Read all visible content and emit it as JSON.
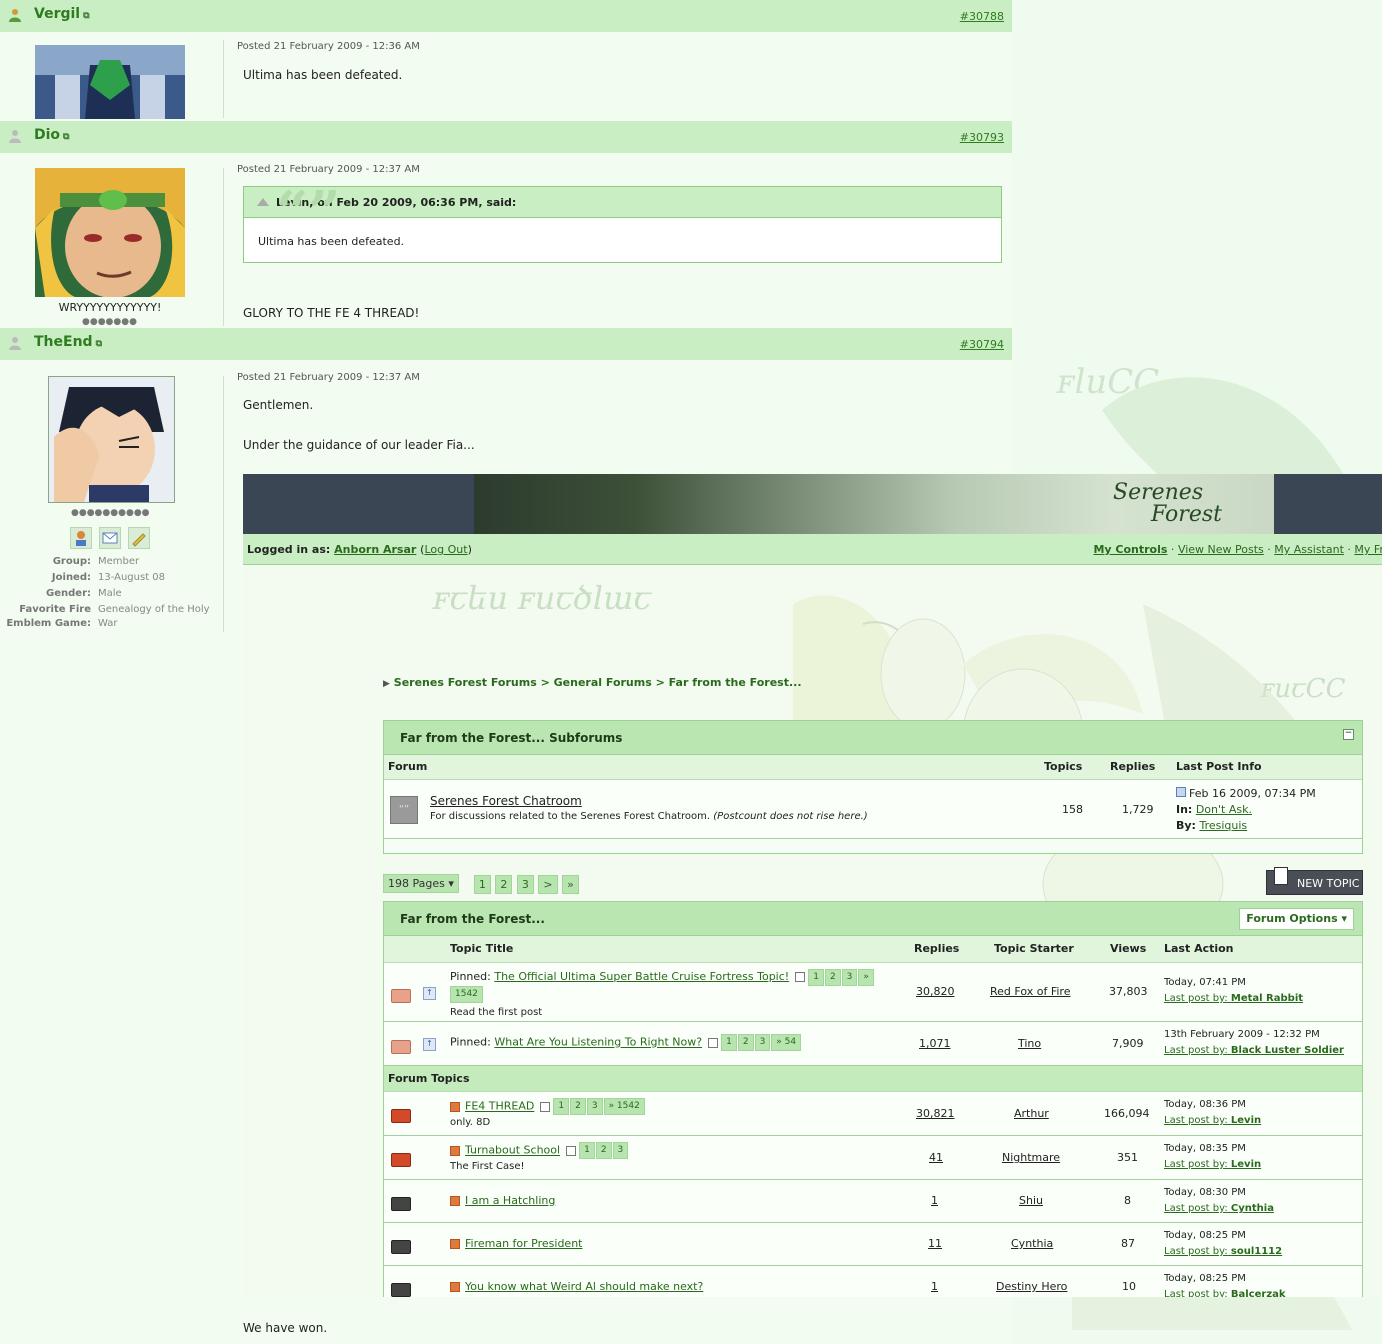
{
  "posts": [
    {
      "user": "Vergil",
      "post_id": "#30788",
      "posted": "Posted 21 February 2009 - 12:36 AM",
      "body": "Ultima has been defeated."
    },
    {
      "user": "Dio",
      "post_id": "#30793",
      "posted": "Posted 21 February 2009 - 12:37 AM",
      "quote_header": "Levin, on Feb 20 2009, 06:36 PM, said:",
      "quote_body": "Ultima has been defeated.",
      "body": "GLORY TO THE FE 4 THREAD!",
      "title": "WRYYYYYYYYYYYY!"
    },
    {
      "user": "TheEnd",
      "post_id": "#30794",
      "posted": "Posted 21 February 2009 - 12:37 AM",
      "body_line1": "Gentlemen.",
      "body_line2": "Under the guidance of our leader Fia...",
      "pips": "●●●●●●●●●●",
      "profile": [
        {
          "label": "Group:",
          "value": "Member"
        },
        {
          "label": "Joined:",
          "value": "13-August 08"
        },
        {
          "label": "Gender:",
          "value": "Male"
        },
        {
          "label": "Favorite Fire",
          "value": "Genealogy of the Holy"
        },
        {
          "label": "Emblem Game:",
          "value": "War"
        }
      ],
      "after_text": "We have won."
    }
  ],
  "icons": {
    "user": "user-icon",
    "external": "external-link-icon",
    "quote": "quote-icon"
  },
  "forum": {
    "logo_line1": "Serenes",
    "logo_line2": "Forest",
    "logged_in_label": "Logged in as:",
    "logged_in_user": "Anborn Arsar",
    "logout_label": "Log Out",
    "nav": [
      "My Controls",
      "View New Posts",
      "My Assistant",
      "My Fri"
    ],
    "breadcrumb": [
      "Serenes Forest Forums",
      "General Forums",
      "Far from the Forest..."
    ],
    "subforums": {
      "title": "Far from the Forest... Subforums",
      "columns": [
        "Forum",
        "Topics",
        "Replies",
        "Last Post Info"
      ],
      "rows": [
        {
          "name": "Serenes Forest Chatroom",
          "desc": "For discussions related to the Serenes Forest Chatroom.",
          "desc_note": "(Postcount does not rise here.)",
          "topics": "158",
          "replies": "1,729",
          "last_date": "Feb 16 2009, 07:34 PM",
          "in_label": "In:",
          "in_topic": "Don't Ask.",
          "by_label": "By:",
          "by_user": "Tresiquis"
        }
      ]
    },
    "pagination": {
      "pages_label": "198 Pages",
      "links": [
        "1",
        "2",
        "3",
        ">",
        "»"
      ]
    },
    "new_topic_label": "NEW TOPIC",
    "topics": {
      "title": "Far from the Forest...",
      "options_label": "Forum Options",
      "columns": [
        "Topic Title",
        "Replies",
        "Topic Starter",
        "Views",
        "Last Action"
      ],
      "section_label": "Forum Topics",
      "pinned_prefix": "Pinned:",
      "last_post_by_label": "Last post by:",
      "pinned": [
        {
          "title": "The Official Ultima Super Battle Cruise Fortress Topic!",
          "pages": [
            "1",
            "2",
            "3",
            "»"
          ],
          "last_page": "1542",
          "desc": "Read the first post",
          "replies": "30,820",
          "starter": "Red Fox of Fire",
          "views": "37,803",
          "last_date": "Today, 07:41 PM",
          "last_by": "Metal Rabbit"
        },
        {
          "title": "What Are You Listening To Right Now?",
          "pages": [
            "1",
            "2",
            "3",
            "» 54"
          ],
          "replies": "1,071",
          "starter": "Tino",
          "views": "7,909",
          "last_date": "13th February 2009 - 12:32 PM",
          "last_by": "Black Luster Soldier"
        }
      ],
      "rows": [
        {
          "title": "FE4 THREAD",
          "pages": [
            "1",
            "2",
            "3",
            "» 1542"
          ],
          "desc": "only. 8D",
          "replies": "30,821",
          "starter": "Arthur",
          "views": "166,094",
          "last_date": "Today, 08:36 PM",
          "last_by": "Levin"
        },
        {
          "title": "Turnabout School",
          "pages": [
            "1",
            "2",
            "3"
          ],
          "desc": "The First Case!",
          "replies": "41",
          "starter": "Nightmare",
          "views": "351",
          "last_date": "Today, 08:35 PM",
          "last_by": "Levin"
        },
        {
          "title": "I am a Hatchling",
          "pages": [],
          "desc": "",
          "replies": "1",
          "starter": "Shiu",
          "views": "8",
          "last_date": "Today, 08:30 PM",
          "last_by": "Cynthia"
        },
        {
          "title": "Fireman for President",
          "pages": [],
          "desc": "",
          "replies": "11",
          "starter": "Cynthia",
          "views": "87",
          "last_date": "Today, 08:25 PM",
          "last_by": "soul1112"
        },
        {
          "title": "You know what Weird Al should make next?",
          "pages": [],
          "desc": "",
          "replies": "1",
          "starter": "Destiny Hero",
          "views": "10",
          "last_date": "Today, 08:25 PM",
          "last_by": "Balcerzak"
        }
      ]
    }
  }
}
